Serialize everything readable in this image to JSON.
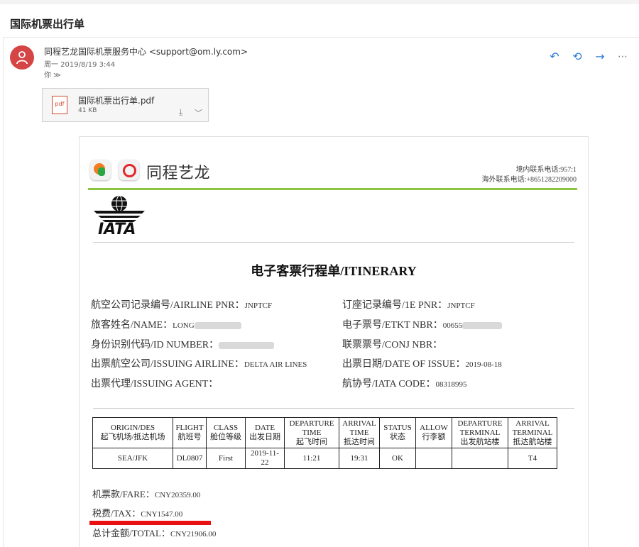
{
  "email": {
    "subject": "国际机票出行单",
    "sender": "同程艺龙国际机票服务中心 <support@om.ly.com>",
    "date": "周一 2019/8/19 3:44",
    "to": "你 ≫",
    "attachment": {
      "name": "国际机票出行单.pdf",
      "size": "41 KB",
      "icon": "pdf"
    },
    "actions": [
      "reply-icon",
      "reply-all-icon",
      "forward-icon",
      "more-icon"
    ]
  },
  "doc": {
    "brand": "同程艺龙",
    "contact_domestic": "境内联系电话:957:1",
    "contact_overseas": "海外联系电话:+8651282209000",
    "iata_text": "IATA",
    "title_cn": "电子客票行程单",
    "title_en": "/ITINERARY",
    "fields": {
      "pnr_label": "航空公司记录编号/AIRLINE PNR：",
      "pnr_value": "JNPTCF",
      "name_label": "旅客姓名/NAME：",
      "name_value": "LONG",
      "id_label": "身份识别代码/ID NUMBER：",
      "airline_label": "出票航空公司/ISSUING AIRLINE：",
      "airline_value": "DELTA AIR LINES",
      "agent_label": "出票代理/ISSUING AGENT：",
      "pnr1e_label": "订座记录编号/1E PNR：",
      "pnr1e_value": "JNPTCF",
      "etkt_label": "电子票号/ETKT NBR：",
      "etkt_value": "00655",
      "conj_label": "联票票号/CONJ NBR：",
      "issue_label": "出票日期/DATE OF ISSUE：",
      "issue_value": "2019-08-18",
      "iata_code_label": "航协号/IATA CODE：",
      "iata_code_value": "08318995"
    },
    "table": {
      "headers": [
        [
          "ORIGIN/DES",
          "起飞机场/抵达机场"
        ],
        [
          "FLIGHT",
          "航班号"
        ],
        [
          "CLASS",
          "舱位等级"
        ],
        [
          "DATE",
          "出发日期"
        ],
        [
          "DEPARTURE",
          "TIME",
          "起飞时间"
        ],
        [
          "ARRIVAL",
          "TIME",
          "抵达时间"
        ],
        [
          "STATUS",
          "状态"
        ],
        [
          "ALLOW",
          "行李额"
        ],
        [
          "DEPARTURE",
          "TERMINAL",
          "出发航站楼"
        ],
        [
          "ARRIVAL",
          "TERMINAL",
          "抵达航站楼"
        ]
      ],
      "rows": [
        [
          "SEA/JFK",
          "DL0807",
          "First",
          "2019-11-22",
          "11:21",
          "19:31",
          "OK",
          "",
          "",
          "T4"
        ]
      ]
    },
    "fare_label": "机票款/FARE：",
    "fare_value": "CNY20359.00",
    "tax_label": "税费/TAX：",
    "tax_value": "CNY1547.00",
    "total_label": "总计金额/TOTAL：",
    "total_value": "CNY21906.00",
    "accent_green": "#8cc63f",
    "accent_red": "#e81010"
  }
}
